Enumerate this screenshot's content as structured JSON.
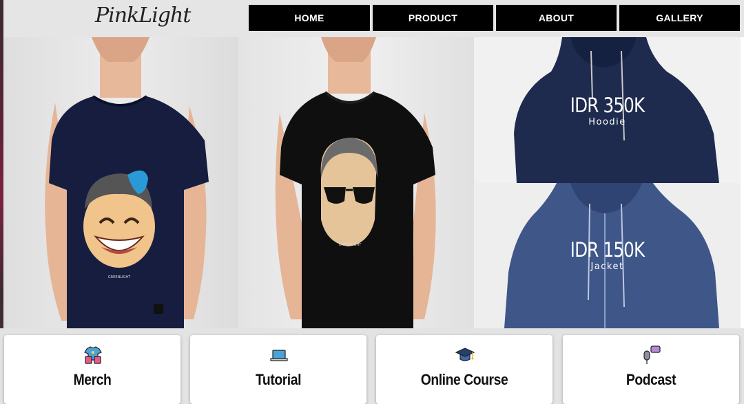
{
  "brand": {
    "logo": "PinkLight"
  },
  "nav": {
    "items": [
      "HOME",
      "PRODUCT",
      "ABOUT",
      "GALLERY"
    ]
  },
  "products": [
    {
      "price": "IDR 350K",
      "name": "Hoodie"
    },
    {
      "price": "IDR 150K",
      "name": "Jacket"
    }
  ],
  "shirt_print_text": "GREENLIGHT",
  "cards": [
    {
      "label": "Merch",
      "icon": "tshirt-bag-icon"
    },
    {
      "label": "Tutorial",
      "icon": "laptop-icon"
    },
    {
      "label": "Online Course",
      "icon": "graduation-cap-icon"
    },
    {
      "label": "Podcast",
      "icon": "microphone-icon"
    }
  ]
}
